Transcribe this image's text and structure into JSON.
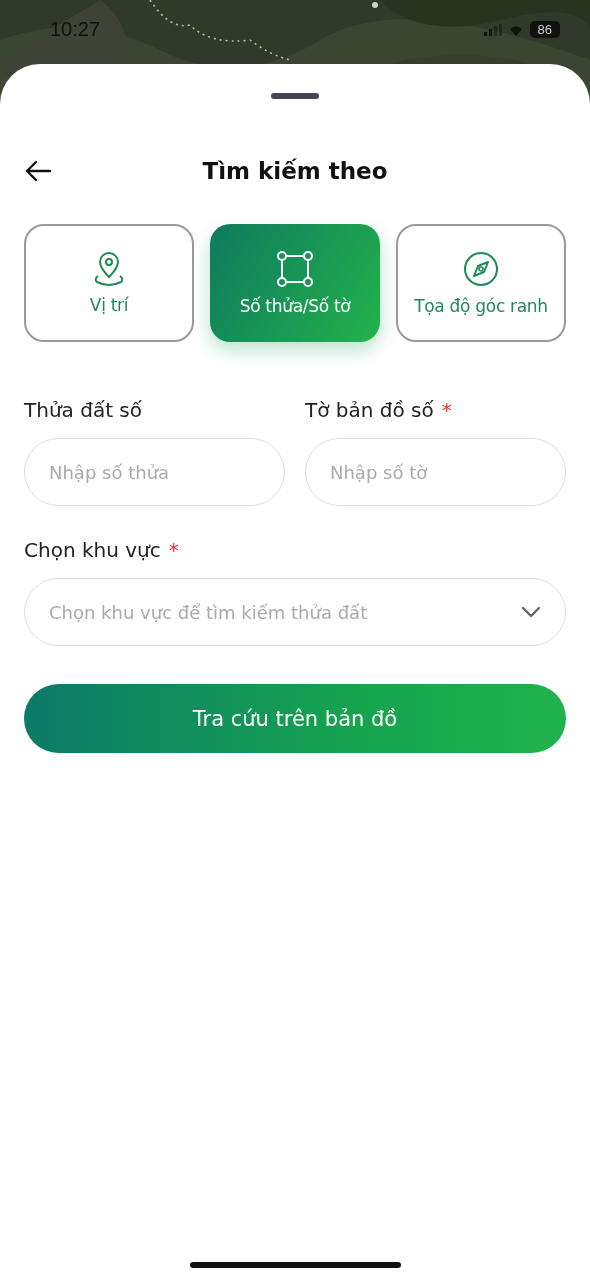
{
  "status_bar": {
    "time": "10:27",
    "battery": "86"
  },
  "sheet": {
    "title": "Tìm kiếm theo"
  },
  "tabs": [
    {
      "label": "Vị trí",
      "kind": "pin",
      "selected": false
    },
    {
      "label": "Số thửa/Số tờ",
      "kind": "polygon",
      "selected": true
    },
    {
      "label": "Tọa độ góc ranh",
      "kind": "compass",
      "selected": false
    }
  ],
  "fields": [
    {
      "label": "Thửa đất số",
      "placeholder": "Nhập số thửa"
    },
    {
      "label": "Tờ bản đồ số",
      "required_mark": "*",
      "placeholder": "Nhập số tờ"
    }
  ],
  "area": {
    "label": "Chọn khu vực",
    "required_mark": "*",
    "placeholder": "Chọn khu vực để tìm kiếm thửa đất"
  },
  "submit": {
    "label": "Tra cứu trên bản đồ"
  }
}
